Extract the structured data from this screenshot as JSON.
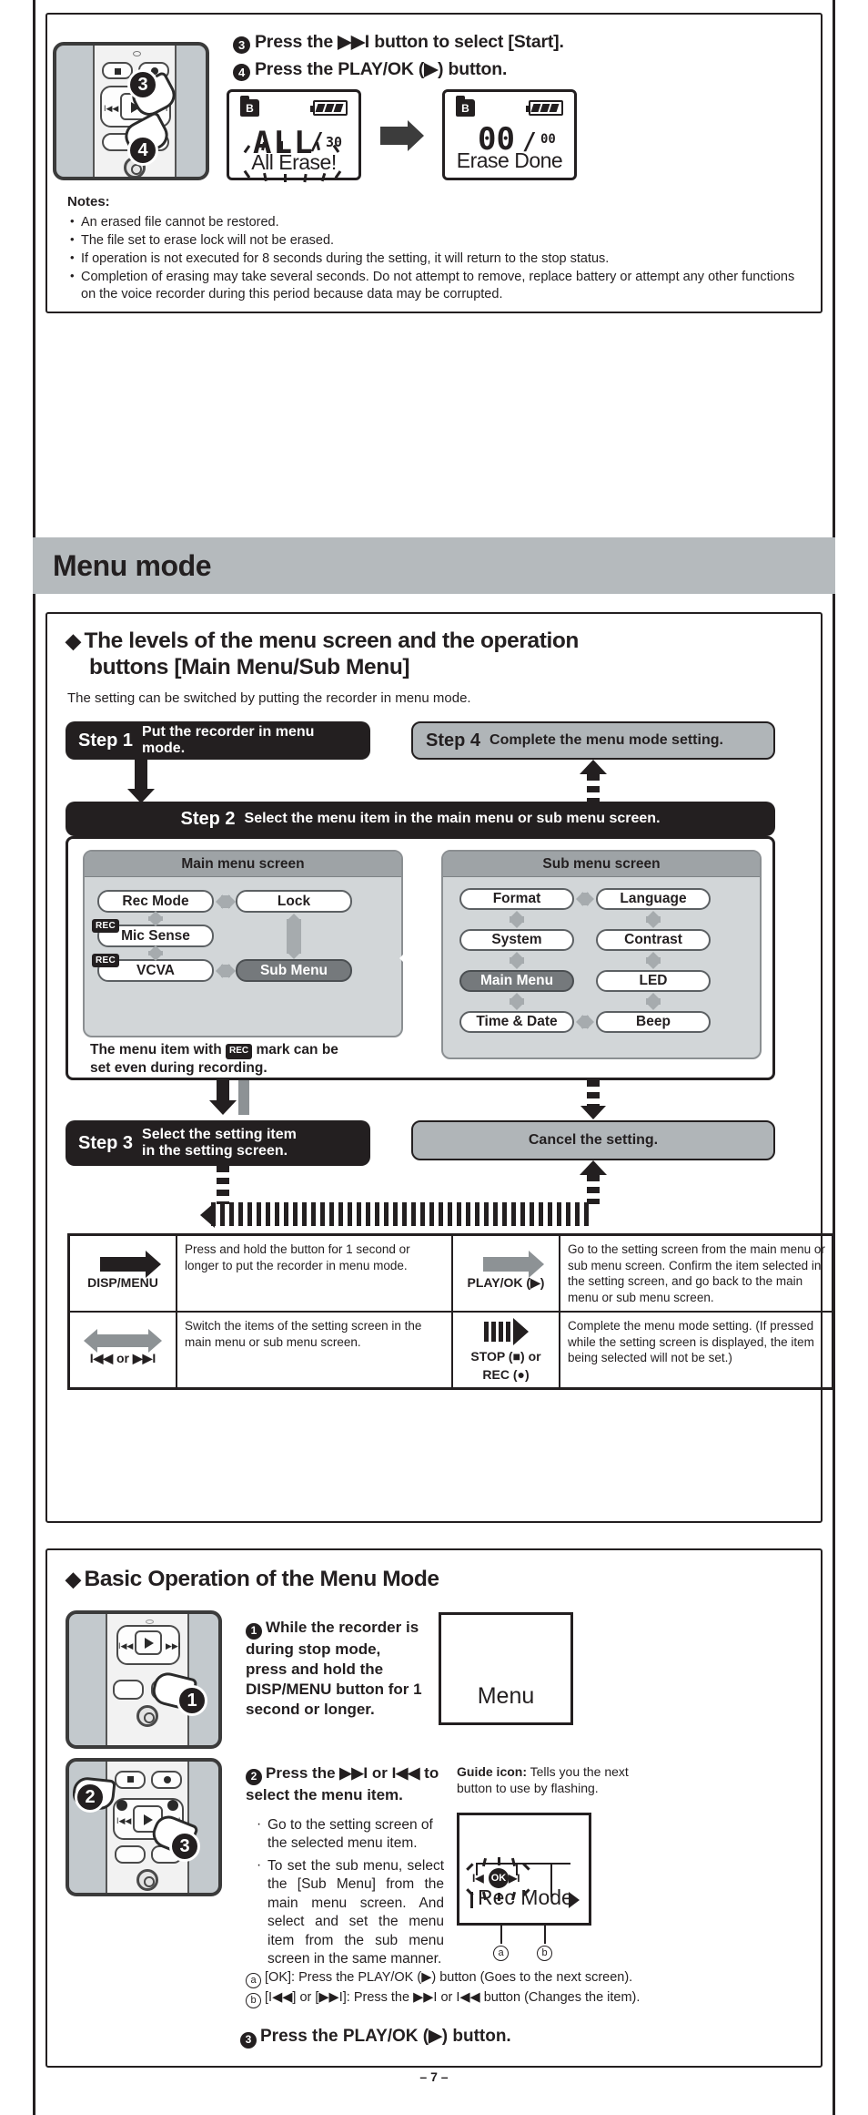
{
  "page": {
    "footer": "– 7 –"
  },
  "erase_section": {
    "steps": [
      {
        "num": "3",
        "text_parts": [
          "Press the ",
          "▶▶I",
          " button to select [",
          "Start",
          "]."
        ]
      },
      {
        "num": "4",
        "text_parts": [
          "Press the ",
          "PLAY/OK",
          " (",
          "▶",
          ") button."
        ]
      }
    ],
    "step3_plain": "Press the ▶▶I button to select [Start].",
    "step4_plain": "Press the PLAY/OK (▶) button.",
    "lcd_before": {
      "folder_label": "B",
      "segment_main": "ALL",
      "segment_slash": "/",
      "segment_total": "30",
      "word": "All Erase!"
    },
    "lcd_after": {
      "folder_label": "B",
      "segment_main": "00",
      "segment_slash": "/",
      "segment_total": "00",
      "word": "Erase Done"
    },
    "notes_title": "Notes:",
    "notes": [
      "An erased file cannot be restored.",
      "The file set to erase lock will not be erased.",
      "If operation is not executed for 8 seconds during the setting, it will return to the stop status.",
      "Completion of erasing may take several seconds. Do not attempt to remove, replace battery or attempt any other functions on the voice recorder during this period because data may be corrupted."
    ],
    "device_callouts": [
      "3",
      "4"
    ]
  },
  "banner": {
    "title": "Menu mode"
  },
  "menu_section": {
    "heading_line1": "The levels of the menu screen and the operation",
    "heading_line2": "buttons [Main Menu/Sub Menu]",
    "subtitle": "The setting can be switched by putting the recorder in menu mode.",
    "step1": {
      "label": "Step 1",
      "text": "Put the recorder in menu mode."
    },
    "step2": {
      "label": "Step 2",
      "text": "Select the menu item in the main menu or sub menu screen."
    },
    "step3": {
      "label": "Step 3",
      "text_line1": "Select the setting item",
      "text_line2": "in the setting screen."
    },
    "step4": {
      "label": "Step 4",
      "text": "Complete the menu mode setting."
    },
    "cancel": {
      "text": "Cancel the setting."
    },
    "main_menu": {
      "title": "Main menu screen",
      "items": [
        {
          "label": "Rec Mode",
          "rec": false,
          "selected": false
        },
        {
          "label": "Lock",
          "rec": false,
          "selected": false
        },
        {
          "label": "Mic Sense",
          "rec": true,
          "selected": false
        },
        {
          "label": "VCVA",
          "rec": true,
          "selected": false
        },
        {
          "label": "Sub Menu",
          "rec": false,
          "selected": true
        }
      ],
      "rec_tag": "REC",
      "note_line1": "The menu item with",
      "note_line2": "mark can be",
      "note_line3": "set even during recording."
    },
    "sub_menu": {
      "title": "Sub menu screen",
      "items": [
        {
          "label": "Format",
          "selected": false
        },
        {
          "label": "Language",
          "selected": false
        },
        {
          "label": "System",
          "selected": false
        },
        {
          "label": "Contrast",
          "selected": false
        },
        {
          "label": "Main Menu",
          "selected": true
        },
        {
          "label": "LED",
          "selected": false
        },
        {
          "label": "Time & Date",
          "selected": false
        },
        {
          "label": "Beep",
          "selected": false
        }
      ]
    },
    "legend": {
      "rows": [
        {
          "icon_left_label": "DISP/MENU",
          "text_left": "Press and hold the button for 1 second or longer to put the recorder in menu mode.",
          "icon_right_label": "PLAY/OK (▶)",
          "text_right": "Go to the setting screen from the main menu or sub menu screen. Confirm the item selected in the setting screen, and go back to the main menu or sub menu screen."
        },
        {
          "icon_left_label": "I◀◀ or ▶▶I",
          "text_left": "Switch the items of the setting screen in the main menu or sub menu screen.",
          "icon_right_label_line1": "STOP (■) or",
          "icon_right_label_line2": "REC (●)",
          "text_right": "Complete the menu mode setting. (If pressed while the setting screen is displayed, the item being selected will not be set.)"
        }
      ]
    }
  },
  "basic_section": {
    "heading": "Basic Operation of the Menu Mode",
    "step1": {
      "num": "1",
      "text": "While the recorder is during stop mode, press and hold the DISP/MENU button for 1 second or longer.",
      "lcd_word": "Menu"
    },
    "step2": {
      "num": "2",
      "title": "Press the ▶▶I or I◀◀ to select the menu item.",
      "bullets": [
        "Go to the setting screen of the selected menu item.",
        "To set the sub menu, select the [Sub Menu] from the main menu screen. And select and set the menu item from the sub menu screen in the same manner."
      ]
    },
    "guide_icon": {
      "label": "Guide icon:",
      "text": "Tells you the next button to use by flashing.",
      "lcd_text": "Rec Mode",
      "ok_label": "OK",
      "marker_a": "a",
      "marker_b": "b"
    },
    "legend_a": "[OK]: Press the PLAY/OK (▶) button (Goes to the next screen).",
    "legend_b": "[I◀◀] or [▶▶I]: Press the ▶▶I or I◀◀ button (Changes the item).",
    "step3": {
      "num": "3",
      "text": "Press the PLAY/OK (▶) button."
    },
    "device_callouts": [
      "1",
      "2",
      "3"
    ]
  }
}
